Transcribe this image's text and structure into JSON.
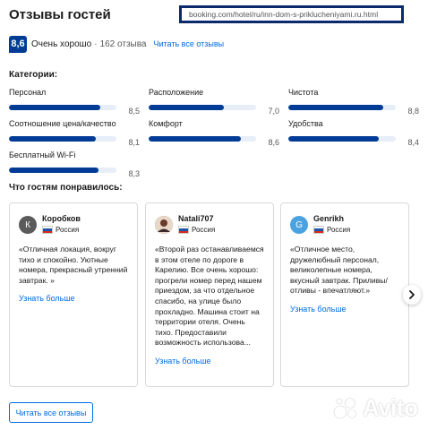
{
  "header": {
    "title": "Отзывы гостей",
    "url": "booking.com/hotel/ru/inn-dom-s-priklucheniyami.ru.html"
  },
  "score": {
    "value": "8,6",
    "label": "Очень хорошо",
    "separator": "·",
    "count": "162 отзыва",
    "read_all": "Читать все отзывы"
  },
  "categories": {
    "title": "Категории:",
    "items": [
      {
        "name": "Персонал",
        "score": "8,5",
        "value": 8.5
      },
      {
        "name": "Расположение",
        "score": "7,0",
        "value": 7.0
      },
      {
        "name": "Чистота",
        "score": "8,8",
        "value": 8.8
      },
      {
        "name": "Соотношение цена/качество",
        "score": "8,1",
        "value": 8.1
      },
      {
        "name": "Комфорт",
        "score": "8,6",
        "value": 8.6
      },
      {
        "name": "Удобства",
        "score": "8,4",
        "value": 8.4
      },
      {
        "name": "Бесплатный Wi-Fi",
        "score": "8,3",
        "value": 8.3
      }
    ]
  },
  "liked": {
    "title": "Что гостям понравилось:"
  },
  "reviews": [
    {
      "initial": "К",
      "avatar_color": "#5a5a5a",
      "author": "Коробков",
      "country": "Россия",
      "text": "«Отличная локация, вокруг тихо и спокойно. Уютные номера, прекрасный утренний завтрак. »",
      "more": "Узнать больше"
    },
    {
      "initial": "",
      "avatar_color": "#7a4a3a",
      "author": "Natali707",
      "country": "Россия",
      "text": "«Второй раз останавливаемся в этом отеле по дороге в Карелию. Все очень хорошо: прогрели номер перед нашем приездом, за что отдельное спасибо, на улице было прохладно. Машина стоит на территории отеля. Очень тихо. Предоставили возможность использова...",
      "more": "Узнать больше"
    },
    {
      "initial": "G",
      "avatar_color": "#4aa3e0",
      "author": "Genrikh",
      "country": "Россия",
      "text": "«Отличное место, дружелюбный персонал, великолепные номера, вкусный завтрак. Приливы/отливы - впечатляют.»",
      "more": "Узнать больше"
    }
  ],
  "button": {
    "read_all": "Читать все отзывы"
  },
  "watermark": {
    "text": "Avito"
  },
  "colors": {
    "brand_blue": "#003b95",
    "link_blue": "#006ce4",
    "track": "#e7eef8"
  }
}
